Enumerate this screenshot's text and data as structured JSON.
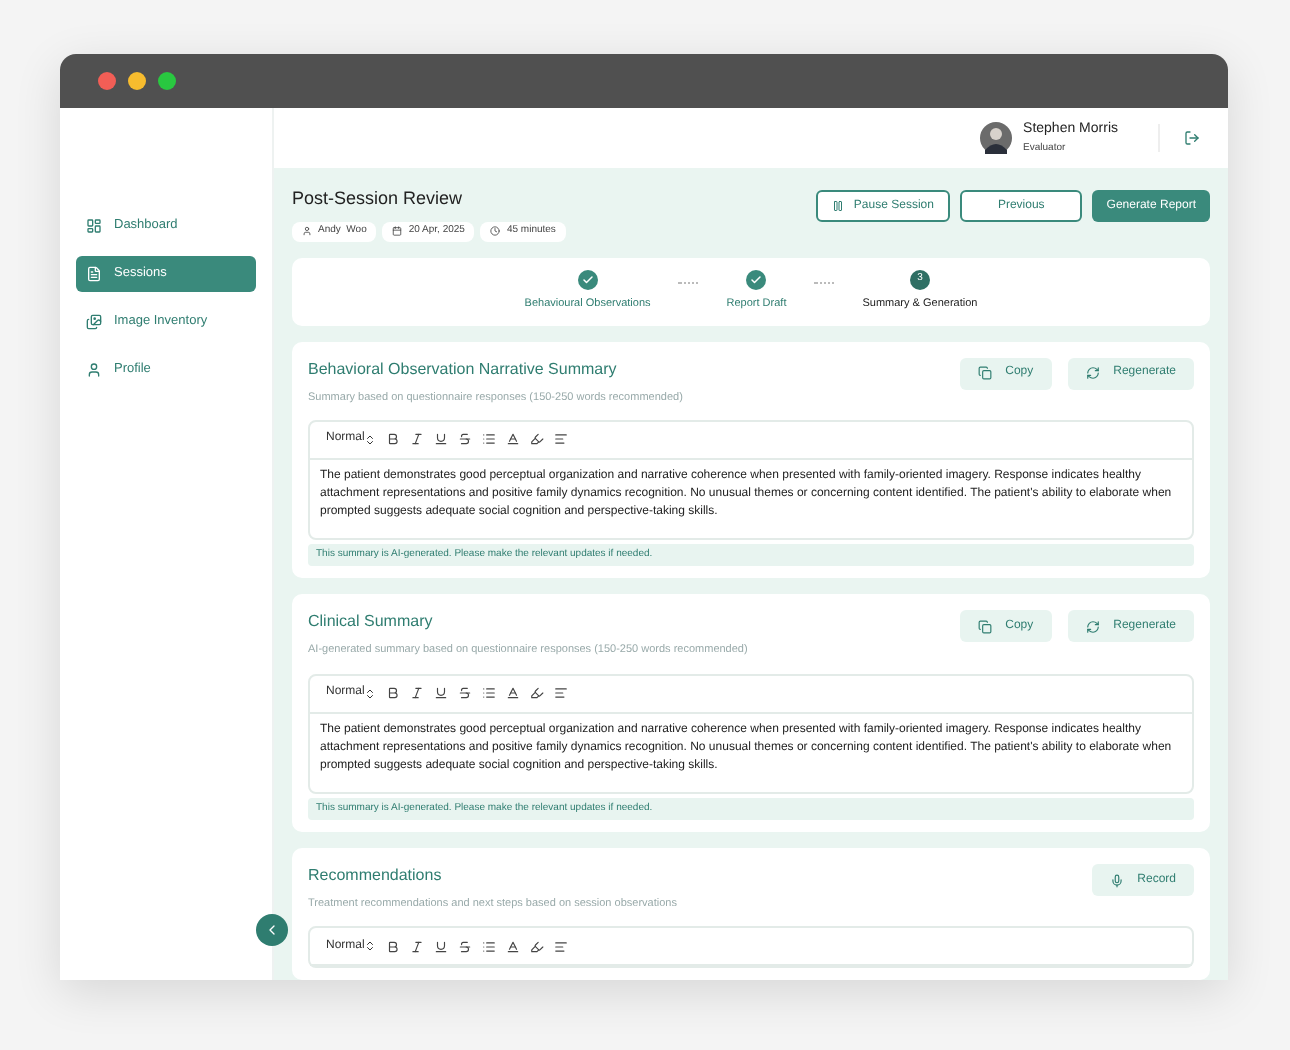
{
  "sidebar": {
    "items": [
      {
        "label": "Dashboard",
        "kind": "dashboard",
        "selected": false
      },
      {
        "label": "Sessions",
        "kind": "sessions",
        "selected": true
      },
      {
        "label": "Image Inventory",
        "kind": "images",
        "selected": false
      },
      {
        "label": "Profile",
        "kind": "profile",
        "selected": false
      }
    ]
  },
  "user": {
    "name": "Stephen Morris",
    "role": "Evaluator"
  },
  "page": {
    "title": "Post-Session Review",
    "meta": [
      {
        "kind": "user",
        "text": "Andy  Woo"
      },
      {
        "kind": "calendar",
        "text": "20 Apr, 2025"
      },
      {
        "kind": "clock",
        "text": "45 minutes"
      }
    ],
    "buttons": [
      {
        "kind": "pause",
        "label": "Pause Session"
      },
      {
        "kind": "outline",
        "label": "Previous"
      },
      {
        "kind": "primary",
        "label": "Generate Report"
      }
    ]
  },
  "steps": [
    {
      "label": "Behavioural Observations",
      "completed": true
    },
    {
      "label": "Report Draft",
      "completed": true
    },
    {
      "label": "Summary & Generation",
      "completed": false,
      "number": "3"
    }
  ],
  "sections": [
    {
      "title": "Behavioral Observation Narrative Summary",
      "subtitle": "Summary based on questionnaire responses (150-250 words recommended)",
      "actions": [
        {
          "kind": "copy",
          "label": "Copy"
        },
        {
          "kind": "regenerate",
          "label": "Regenerate"
        }
      ],
      "editor": {
        "format": "Normal",
        "text": "The patient demonstrates good perceptual organization and narrative coherence when presented with family-oriented imagery. Response indicates healthy attachment representations and positive family dynamics recognition. No unusual themes or concerning content identified. The patient's ability to elaborate when prompted suggests adequate social cognition and perspective-taking skills."
      },
      "note": "This summary is AI-generated. Please make the relevant updates if needed."
    },
    {
      "title": "Clinical Summary",
      "subtitle": "AI-generated summary based on questionnaire responses (150-250 words recommended)",
      "actions": [
        {
          "kind": "copy",
          "label": "Copy"
        },
        {
          "kind": "regenerate",
          "label": "Regenerate"
        }
      ],
      "editor": {
        "format": "Normal",
        "text": "The patient demonstrates good perceptual organization and narrative coherence when presented with family-oriented imagery. Response indicates healthy attachment representations and positive family dynamics recognition. No unusual themes or concerning content identified. The patient's ability to elaborate when prompted suggests adequate social cognition and perspective-taking skills."
      },
      "note": "This summary is AI-generated. Please make the relevant updates if needed."
    },
    {
      "title": "Recommendations",
      "subtitle": "Treatment recommendations and next steps based on session observations",
      "actions": [
        {
          "kind": "record",
          "label": "Record"
        }
      ],
      "editor": {
        "format": "Normal"
      }
    }
  ]
}
